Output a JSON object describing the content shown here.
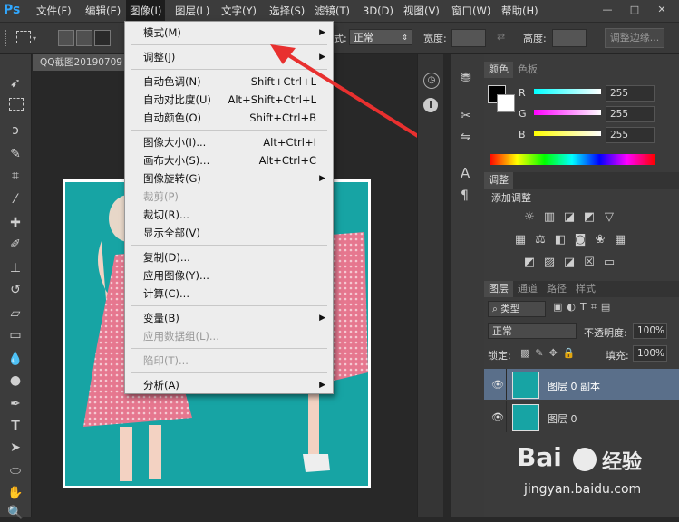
{
  "app": {
    "logo": "Ps"
  },
  "menubar": {
    "items": [
      "文件(F)",
      "编辑(E)",
      "图像(I)",
      "图层(L)",
      "文字(Y)",
      "选择(S)",
      "滤镜(T)",
      "3D(D)",
      "视图(V)",
      "窗口(W)",
      "帮助(H)"
    ],
    "active_index": 2
  },
  "window_controls": {
    "minimize": "—",
    "maximize": "□",
    "close": "✕"
  },
  "options_bar": {
    "style_partial": "式:",
    "style_value": "正常",
    "width_label": "宽度:",
    "height_label": "高度:",
    "refine_button": "调整边缘..."
  },
  "document": {
    "tab_title": "QQ截图20190709"
  },
  "image_menu": {
    "items": [
      {
        "label": "模式(M)",
        "shortcut": "",
        "submenu": true,
        "disabled": false
      },
      {
        "sep": true
      },
      {
        "label": "调整(J)",
        "shortcut": "",
        "submenu": true,
        "disabled": false
      },
      {
        "sep": true
      },
      {
        "label": "自动色调(N)",
        "shortcut": "Shift+Ctrl+L",
        "submenu": false,
        "disabled": false
      },
      {
        "label": "自动对比度(U)",
        "shortcut": "Alt+Shift+Ctrl+L",
        "submenu": false,
        "disabled": false
      },
      {
        "label": "自动颜色(O)",
        "shortcut": "Shift+Ctrl+B",
        "submenu": false,
        "disabled": false
      },
      {
        "sep": true
      },
      {
        "label": "图像大小(I)...",
        "shortcut": "Alt+Ctrl+I",
        "submenu": false,
        "disabled": false
      },
      {
        "label": "画布大小(S)...",
        "shortcut": "Alt+Ctrl+C",
        "submenu": false,
        "disabled": false
      },
      {
        "label": "图像旋转(G)",
        "shortcut": "",
        "submenu": true,
        "disabled": false
      },
      {
        "label": "裁剪(P)",
        "shortcut": "",
        "submenu": false,
        "disabled": true
      },
      {
        "label": "裁切(R)...",
        "shortcut": "",
        "submenu": false,
        "disabled": false
      },
      {
        "label": "显示全部(V)",
        "shortcut": "",
        "submenu": false,
        "disabled": false
      },
      {
        "sep": true
      },
      {
        "label": "复制(D)...",
        "shortcut": "",
        "submenu": false,
        "disabled": false
      },
      {
        "label": "应用图像(Y)...",
        "shortcut": "",
        "submenu": false,
        "disabled": false
      },
      {
        "label": "计算(C)...",
        "shortcut": "",
        "submenu": false,
        "disabled": false
      },
      {
        "sep": true
      },
      {
        "label": "变量(B)",
        "shortcut": "",
        "submenu": true,
        "disabled": false
      },
      {
        "label": "应用数据组(L)...",
        "shortcut": "",
        "submenu": false,
        "disabled": true
      },
      {
        "sep": true
      },
      {
        "label": "陷印(T)...",
        "shortcut": "",
        "submenu": false,
        "disabled": true
      },
      {
        "sep": true
      },
      {
        "label": "分析(A)",
        "shortcut": "",
        "submenu": true,
        "disabled": false
      }
    ]
  },
  "color_panel": {
    "tabs": [
      "颜色",
      "色板"
    ],
    "channels": [
      {
        "label": "R",
        "value": "255",
        "color": "#ff3b3b"
      },
      {
        "label": "G",
        "value": "255",
        "color": "#e040e0"
      },
      {
        "label": "B",
        "value": "255",
        "color": "#f0f040"
      }
    ]
  },
  "adjust_panel": {
    "tab": "调整",
    "subtitle": "添加调整"
  },
  "layers_panel": {
    "tabs": [
      "图层",
      "通道",
      "路径",
      "样式"
    ],
    "filter_kind": "类型",
    "blend_mode": "正常",
    "opacity_label": "不透明度:",
    "opacity_value": "100%",
    "lock_label": "锁定:",
    "fill_label": "填充:",
    "fill_value": "100%",
    "layers": [
      {
        "name": "图层 0 副本",
        "selected": true
      },
      {
        "name": "图层 0",
        "selected": false
      }
    ]
  },
  "watermark": {
    "brand": "Bai",
    "brand_cn": "经验",
    "url": "jingyan.baidu.com"
  },
  "colors": {
    "accent_arrow": "#e8302f",
    "canvas_bg": "#17a4a4"
  }
}
